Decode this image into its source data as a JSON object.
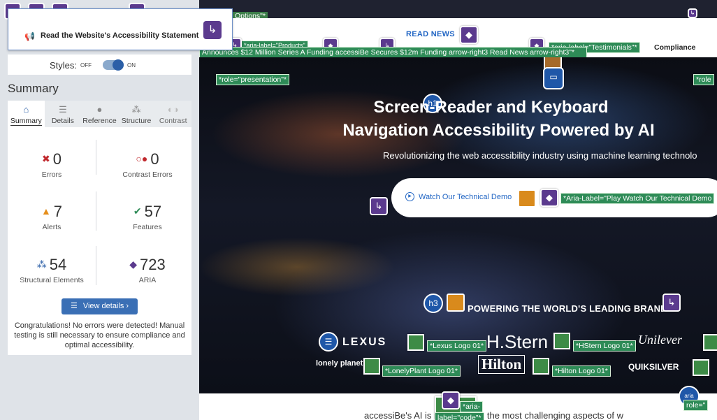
{
  "sidebar": {
    "statement_text": "Read the Website's Accessibility Statement",
    "styles_label": "Styles:",
    "styles_off": "OFF",
    "styles_on": "ON",
    "summary_title": "Summary",
    "tabs": [
      {
        "label": "Summary",
        "icon": "home-icon"
      },
      {
        "label": "Details",
        "icon": "list-icon"
      },
      {
        "label": "Reference",
        "icon": "info-icon"
      },
      {
        "label": "Structure",
        "icon": "structure-icon"
      },
      {
        "label": "Contrast",
        "icon": "contrast-icon"
      }
    ],
    "stats": {
      "errors": {
        "value": "0",
        "label": "Errors"
      },
      "contrast_errors": {
        "value": "0",
        "label": "Contrast Errors"
      },
      "alerts": {
        "value": "7",
        "label": "Alerts"
      },
      "features": {
        "value": "57",
        "label": "Features"
      },
      "structural": {
        "value": "54",
        "label": "Structural Elements"
      },
      "aria": {
        "value": "723",
        "label": "ARIA"
      }
    },
    "view_details": "View details ›",
    "congrats": "Congratulations! No errors were detected! Manual testing is still necessary to ensure compliance and optimal accessibility."
  },
  "page": {
    "options_tag": "Options\"*",
    "read_news": "READ NEWS",
    "compliance": "Compliance",
    "ticker": "Announces $12 Million Series A Funding accessiBe Secures $12m Funding arrow-right3 Read News arrow-right3\"*",
    "aria_testimonials": "*aria-label=\"Testimonials\"*",
    "aria_products": "*aria-label=\"Products\"",
    "role_presentation": "*role=\"presentation\"*",
    "role_right": "*role",
    "h1_badge": "h1",
    "h3_badge": "h3",
    "hero_title_1": "Screen-Reader and Keyboard",
    "hero_title_2": "Navigation Accessibility Powered by AI",
    "hero_sub": "Revolutionizing the web accessibility industry using machine learning technolo",
    "demo_label": "Watch Our Technical Demo",
    "aria_demo": "*Aria-Label=\"Play Watch Our Technical Demo",
    "brands_title": "POWERING THE WORLD'S LEADING BRANDS",
    "brands": {
      "lexus": "LEXUS",
      "hstern": "H.Stern",
      "unilever": "Unilever",
      "lonely": "lonely planet",
      "hilton": "Hilton",
      "quik": "QUIKSILVER"
    },
    "logo_tags": {
      "lexus": "*Lexus Logo 01*",
      "hstern": "*HStern Logo 01*",
      "lonely": "*LonelyPlant Logo 01*",
      "hilton": "*Hilton Logo 01*"
    },
    "aria_bottom": "*aria-",
    "label_code": "label=\"code\"*",
    "role_bottom": "role=\"",
    "aria_circle": "aria",
    "below_text": "accessiBe's AI is r        or handling the most challenging aspects of w"
  }
}
